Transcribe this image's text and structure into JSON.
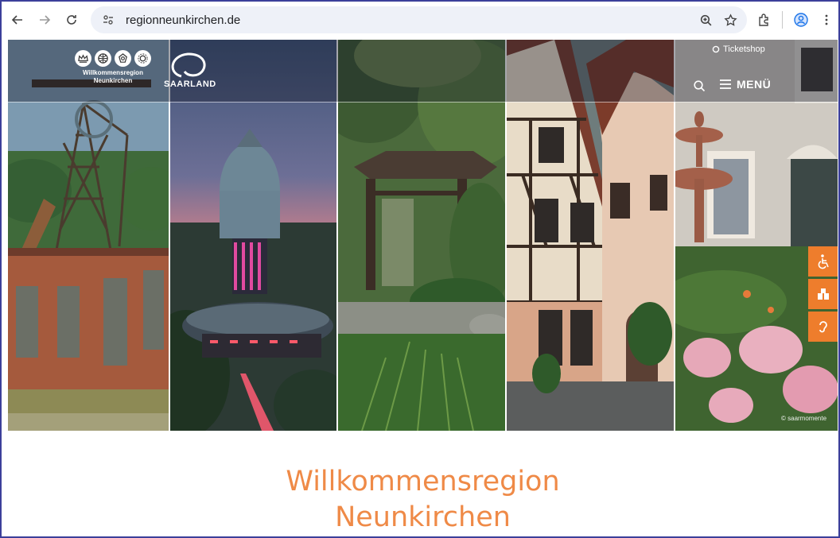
{
  "browser": {
    "url": "regionneunkirchen.de",
    "icons": [
      "back-icon",
      "forward-icon",
      "reload-icon",
      "site-settings-icon",
      "zoom-icon",
      "star-icon",
      "extensions-icon",
      "profile-icon",
      "more-icon"
    ]
  },
  "site": {
    "logo_text_line1": "Willkommensregion",
    "logo_text_line2": "Neunkirchen",
    "saarland_text": "SAARLAND",
    "ticketshop_label": "Ticketshop",
    "menu_label": "MENÜ",
    "photo_credit": "© saarmomente",
    "headline_line1": "Willkommensregion",
    "headline_line2": "Neunkirchen",
    "side_tabs": [
      "accessibility-icon",
      "easy-language-icon",
      "hearing-icon"
    ],
    "colors": {
      "accent": "#ee7d2c",
      "headline": "#ef8a47"
    }
  }
}
